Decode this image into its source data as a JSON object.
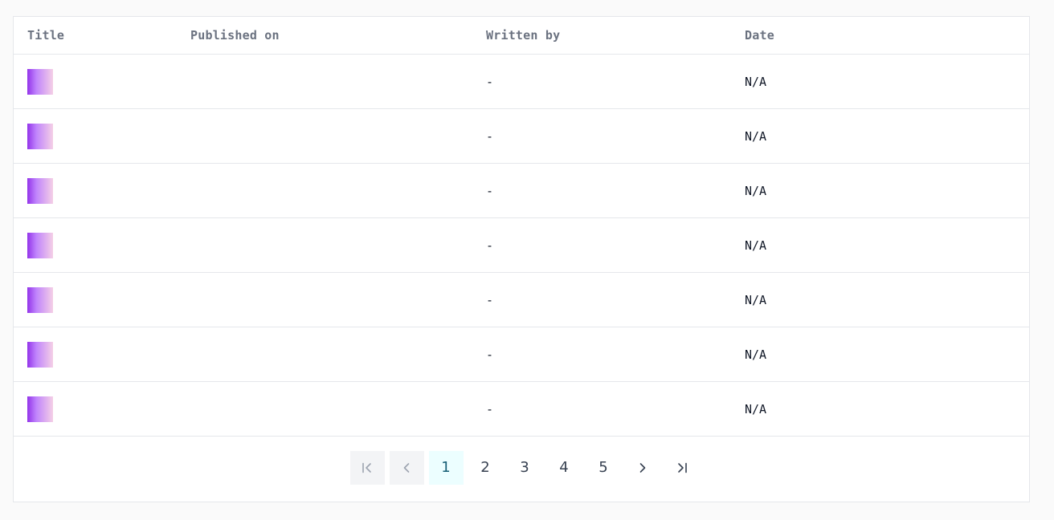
{
  "table": {
    "columns": [
      "Title",
      "Published on",
      "Written by",
      "Date"
    ],
    "rows": [
      {
        "title": "",
        "published_on": "",
        "written_by": "-",
        "date": "N/A"
      },
      {
        "title": "",
        "published_on": "",
        "written_by": "-",
        "date": "N/A"
      },
      {
        "title": "",
        "published_on": "",
        "written_by": "-",
        "date": "N/A"
      },
      {
        "title": "",
        "published_on": "",
        "written_by": "-",
        "date": "N/A"
      },
      {
        "title": "",
        "published_on": "",
        "written_by": "-",
        "date": "N/A"
      },
      {
        "title": "",
        "published_on": "",
        "written_by": "-",
        "date": "N/A"
      },
      {
        "title": "",
        "published_on": "",
        "written_by": "-",
        "date": "N/A"
      }
    ]
  },
  "pagination": {
    "pages": [
      "1",
      "2",
      "3",
      "4",
      "5"
    ],
    "current_page": "1",
    "first_icon": "first-page-icon",
    "prev_icon": "chevron-left-icon",
    "next_icon": "chevron-right-icon",
    "last_icon": "last-page-icon"
  },
  "colors": {
    "active_page_bg": "#ecfeff",
    "active_page_text": "#155e75",
    "thumbnail_gradient_start": "#9333ea",
    "thumbnail_gradient_end": "#f5d0e6"
  }
}
